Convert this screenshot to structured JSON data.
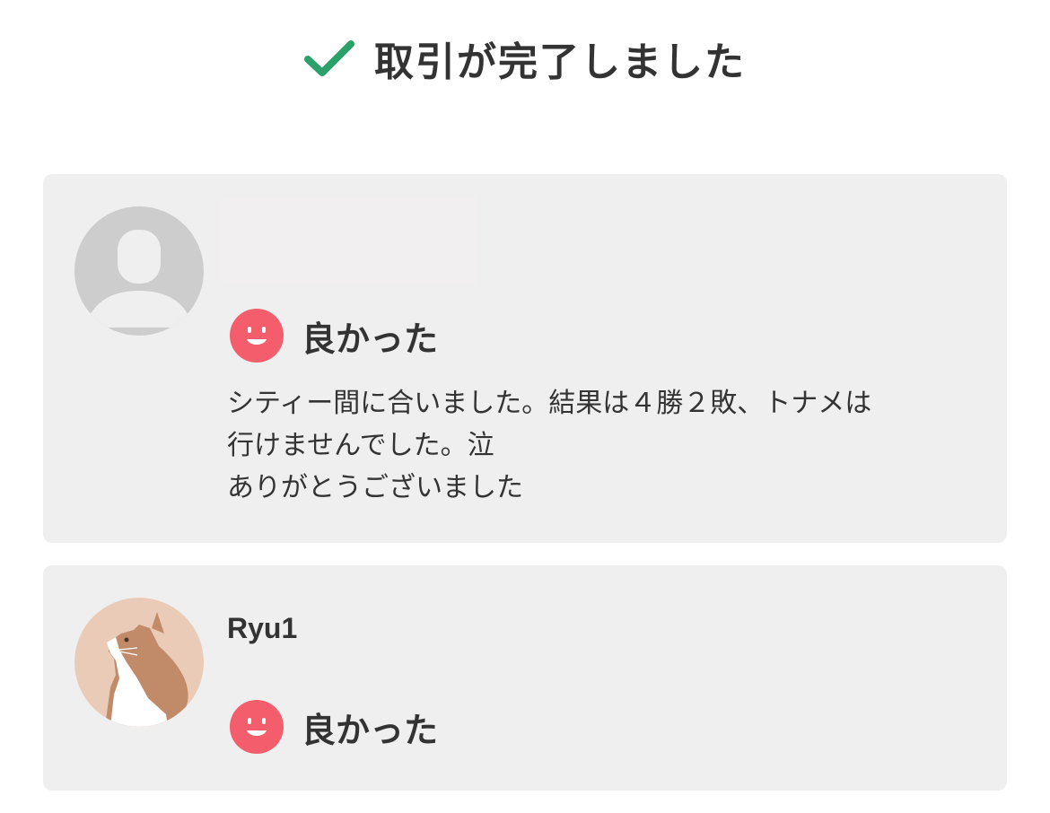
{
  "header": {
    "title": "取引が完了しました",
    "icon": "checkmark-icon",
    "icon_color": "#2aa06a"
  },
  "reviews": [
    {
      "username": "",
      "avatar": "default-user-avatar",
      "rating_icon": "smile-face-icon",
      "rating_color": "#f45d6c",
      "rating_label": "良かった",
      "comment_lines": [
        "シティー間に合いました。結果は４勝２敗、トナメは",
        "行けませんでした。泣",
        "ありがとうございました"
      ]
    },
    {
      "username": "Ryu1",
      "avatar": "cat-avatar",
      "rating_icon": "smile-face-icon",
      "rating_color": "#f45d6c",
      "rating_label": "良かった"
    }
  ]
}
